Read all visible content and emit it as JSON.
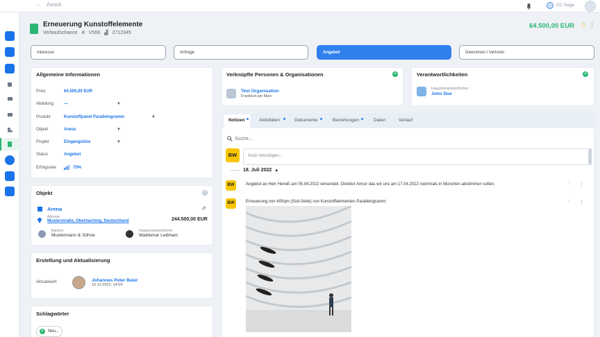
{
  "nav": {
    "back_label": "Zurück"
  },
  "org": {
    "name": "CC Stage"
  },
  "header": {
    "title": "Erneuerung Kunstoffelemente",
    "type": "Verkaufschance",
    "hash": "#",
    "number": "V569",
    "views": "2712345",
    "amount": "64.500,00 EUR"
  },
  "stages": [
    "Interesse",
    "Anfrage",
    "Angebot",
    "Gewonnen / Verloren"
  ],
  "info": {
    "title": "Allgemeine Informationen",
    "rows": [
      {
        "label": "Preis",
        "value": "64.500,00 EUR"
      },
      {
        "label": "Abteilung",
        "value": "—"
      },
      {
        "label": "Produkt",
        "value": "Kunstoffpanel Parallelogramm"
      },
      {
        "label": "Objekt",
        "value": "Arena"
      },
      {
        "label": "Projekt",
        "value": "Eingangstüre"
      },
      {
        "label": "Status",
        "value": "Angebot"
      },
      {
        "label": "Erfolgsrate",
        "value": "75%"
      }
    ]
  },
  "objekt": {
    "title": "Objekt",
    "name": "Arena",
    "address_label": "Adresse",
    "address": "Musterstraße, Oberhaching, Deutschland",
    "amount": "244.500,00 EUR",
    "bauherr_label": "Bauherr",
    "bauherr": "Mustermann & Söhne",
    "verantwortlich_label": "Hauptverantwortlicher",
    "verantwortlich": "Waldemar Leibham"
  },
  "erstellung": {
    "title": "Erstellung und Aktualisierung",
    "label": "Aktualisiert",
    "person": "Johannes Peter Baier",
    "date": "16.12.2022, 14:04"
  },
  "schlagwoerter": {
    "title": "Schlagwörter",
    "add_label": "Neu..."
  },
  "verknuepfte": {
    "title": "Verknüpfte Personen & Organisationen",
    "org_name": "Test Organisation",
    "org_location": "Frankfurt am Main"
  },
  "verantwortlichkeiten": {
    "title": "Verantwortlichkeiten",
    "role": "Hauptverantwortlicher",
    "person": "John Doe"
  },
  "tabs": [
    "Notizen",
    "Aktivitäten",
    "Dokumente",
    "Beziehungen",
    "Daten",
    "Verlauf"
  ],
  "notes": {
    "search_placeholder": "Suche...",
    "add_placeholder": "Notiz hinzufügen...",
    "initials": "BW",
    "date_header": "18. Juli 2022",
    "entries": [
      "Angebot an Herr Honeß am 05.04.2022 versendet. Direktor Annur das wir uns am 17.04.2022 nochmals in München abstimmen sollen.",
      "Erneuerung von 400qm (Süd-Seite) von Kunstoffelementen Parallelogramm:"
    ]
  },
  "colors": {
    "accent": "#2f80ed",
    "green": "#2bb673",
    "yellow": "#f7c600"
  }
}
